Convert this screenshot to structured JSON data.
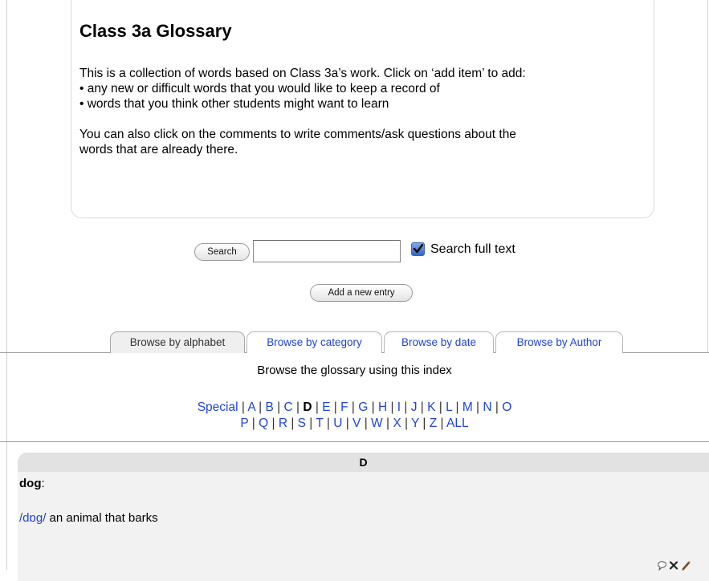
{
  "glossary": {
    "title": "Class 3a Glossary",
    "description_line1": "This is a collection of words based on Class 3a’s work. Click on ‘add item’ to add:",
    "description_bullet1": "• any new or difficult words that you would like to keep a record of",
    "description_bullet2": "• words that you think other students might want to learn",
    "description_line2a": "You can also click on the comments to write comments/ask questions about the",
    "description_line2b": "words that are already there."
  },
  "search": {
    "button_label": "Search",
    "input_value": "",
    "full_text_label": "Search full text",
    "full_text_checked": true
  },
  "add_entry_label": "Add a new entry",
  "tabs": [
    {
      "label": "Browse by alphabet",
      "active": true
    },
    {
      "label": "Browse by category",
      "active": false
    },
    {
      "label": "Browse by date",
      "active": false
    },
    {
      "label": "Browse by Author",
      "active": false
    }
  ],
  "browse_caption": "Browse the glossary using this index",
  "alphabet_row1": [
    "Special",
    "A",
    "B",
    "C",
    "D",
    "E",
    "F",
    "G",
    "H",
    "I",
    "J",
    "K",
    "L",
    "M",
    "N",
    "O"
  ],
  "alphabet_row2": [
    "P",
    "Q",
    "R",
    "S",
    "T",
    "U",
    "V",
    "W",
    "X",
    "Y",
    "Z",
    "ALL"
  ],
  "current_letter": "D",
  "entry": {
    "letter_header": "D",
    "concept": "dog",
    "concept_suffix": ":",
    "phonetic": "/dɒg/",
    "definition": " an animal that barks",
    "icons": [
      "comment-icon",
      "delete-icon",
      "edit-icon"
    ]
  },
  "colors": {
    "link": "#1f44d4",
    "tab_active_bg": "#efefef",
    "entry_bg": "#f2f2f2",
    "entry_header_bg": "#e2e2e2"
  }
}
